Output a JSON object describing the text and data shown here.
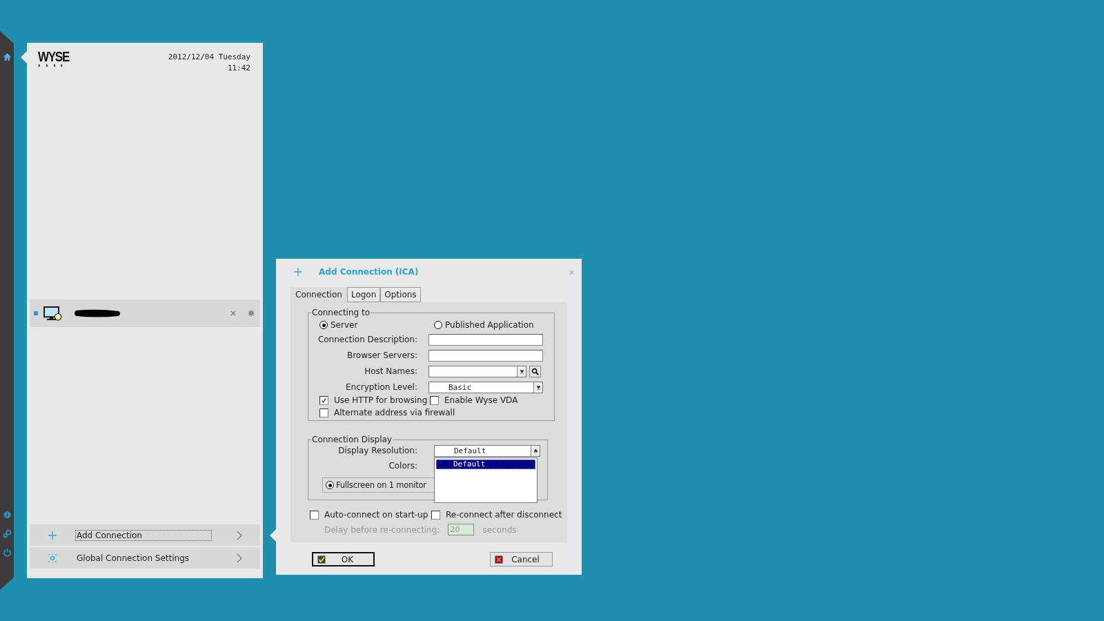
{
  "panel": {
    "logo": "WYSE",
    "date": "2012/12/04 Tuesday",
    "time": "11:42",
    "actions": [
      {
        "kind": "add",
        "label": "Add Connection",
        "focused": true
      },
      {
        "kind": "settings",
        "label": "Global Connection Settings",
        "focused": false
      }
    ]
  },
  "dialog": {
    "title": "Add Connection (ICA)",
    "tabs": [
      {
        "label": "Connection",
        "selected": true
      },
      {
        "label": "Logon",
        "selected": false
      },
      {
        "label": "Options",
        "selected": false
      }
    ],
    "connecting_to": {
      "legend": "Connecting to",
      "radios": [
        {
          "label": "Server",
          "selected": true
        },
        {
          "label": "Published Application",
          "selected": false
        }
      ],
      "fields": [
        {
          "kind": "text",
          "label": "Connection Description:"
        },
        {
          "kind": "text",
          "label": "Browser Servers:"
        },
        {
          "kind": "combo-search",
          "label": "Host Names:"
        },
        {
          "kind": "combo",
          "label": "Encryption Level:",
          "value": "Basic"
        }
      ],
      "checkboxes": [
        {
          "label": "Use HTTP for browsing",
          "checked": true
        },
        {
          "label": "Enable Wyse VDA",
          "checked": false
        },
        {
          "label": "Alternate address via firewall",
          "checked": false
        }
      ]
    },
    "connection_display": {
      "legend": "Connection Display",
      "resolution_label": "Display Resolution:",
      "resolution_value": "Default",
      "colors_label": "Colors:",
      "fullscreen": {
        "label": "Fullscreen on 1 monitor",
        "selected": true
      },
      "dropdown_options": [
        {
          "label": "Default",
          "selected": true
        }
      ]
    },
    "auto_connect": {
      "label": "Auto-connect on start-up",
      "checked": false
    },
    "reconnect": {
      "label": "Re-connect after disconnect",
      "checked": false
    },
    "delay": {
      "label": "Delay before re-connecting:",
      "value": "20",
      "unit": "seconds",
      "disabled": true
    },
    "buttons": [
      {
        "kind": "ok",
        "label": "OK",
        "default": true
      },
      {
        "kind": "cancel",
        "label": "Cancel",
        "default": false
      }
    ]
  }
}
